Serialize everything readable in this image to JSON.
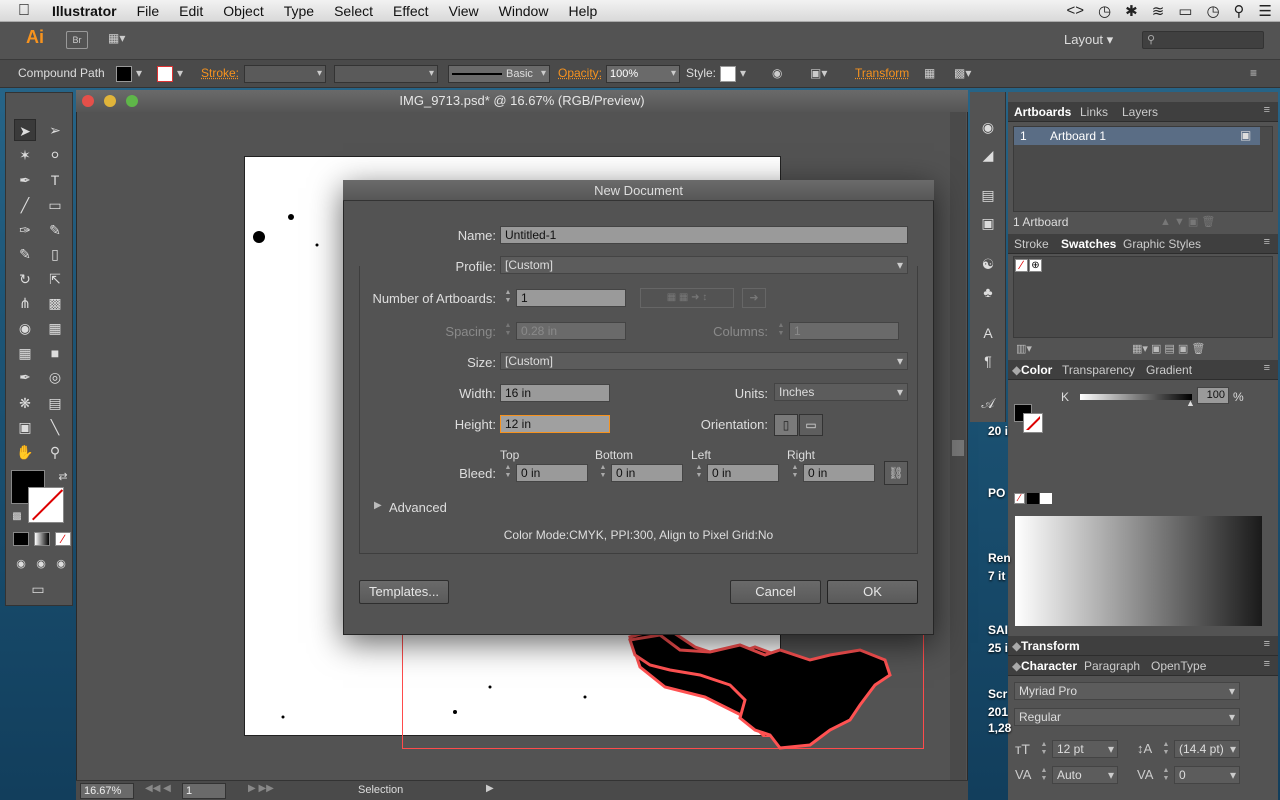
{
  "menubar": {
    "app": "Illustrator",
    "items": [
      "File",
      "Edit",
      "Object",
      "Type",
      "Select",
      "Effect",
      "View",
      "Window",
      "Help"
    ]
  },
  "appbar": {
    "logo": "Ai",
    "bridge": "Br",
    "workspace": "Layout"
  },
  "control": {
    "object_type": "Compound Path",
    "stroke_label": "Stroke:",
    "stroke_profile": "Basic",
    "opacity_label": "Opacity:",
    "opacity_value": "100%",
    "style_label": "Style:",
    "transform_label": "Transform"
  },
  "document": {
    "title": "IMG_9713.psd* @ 16.67% (RGB/Preview)",
    "zoom": "16.67%",
    "artboard_nav": "1",
    "status": "Selection"
  },
  "dialog": {
    "title": "New Document",
    "name_label": "Name:",
    "name_value": "Untitled-1",
    "profile_label": "Profile:",
    "profile_value": "[Custom]",
    "artboards_label": "Number of Artboards:",
    "artboards_value": "1",
    "spacing_label": "Spacing:",
    "spacing_value": "0.28 in",
    "columns_label": "Columns:",
    "columns_value": "1",
    "size_label": "Size:",
    "size_value": "[Custom]",
    "width_label": "Width:",
    "width_value": "16 in",
    "units_label": "Units:",
    "units_value": "Inches",
    "height_label": "Height:",
    "height_value": "12 in",
    "orientation_label": "Orientation:",
    "bleed_label": "Bleed:",
    "bleed_top_label": "Top",
    "bleed_bottom_label": "Bottom",
    "bleed_left_label": "Left",
    "bleed_right_label": "Right",
    "bleed_top": "0 in",
    "bleed_bottom": "0 in",
    "bleed_left": "0 in",
    "bleed_right": "0 in",
    "advanced_label": "Advanced",
    "info": "Color Mode:CMYK, PPI:300, Align to Pixel Grid:No",
    "templates_btn": "Templates...",
    "cancel_btn": "Cancel",
    "ok_btn": "OK"
  },
  "panels": {
    "artboards_tabs": [
      "Artboards",
      "Links",
      "Layers"
    ],
    "artboard_row_num": "1",
    "artboard_row_name": "Artboard 1",
    "artboard_count": "1 Artboard",
    "swatch_tabs": [
      "Stroke",
      "Swatches",
      "Graphic Styles"
    ],
    "color_tabs": [
      "Color",
      "Transparency",
      "Gradient"
    ],
    "color_channel": "K",
    "color_value": "100",
    "color_unit": "%",
    "transform_tab": "Transform",
    "char_tabs": [
      "Character",
      "Paragraph",
      "OpenType"
    ],
    "font_family": "Myriad Pro",
    "font_style": "Regular",
    "font_size": "12 pt",
    "leading": "(14.4 pt)",
    "kerning": "Auto",
    "tracking": "0"
  },
  "desktop": {
    "items": [
      "20 i",
      "PO",
      "Ren",
      "7 it",
      "SAI",
      "25 i",
      "Scr",
      "201",
      "1,28"
    ]
  }
}
